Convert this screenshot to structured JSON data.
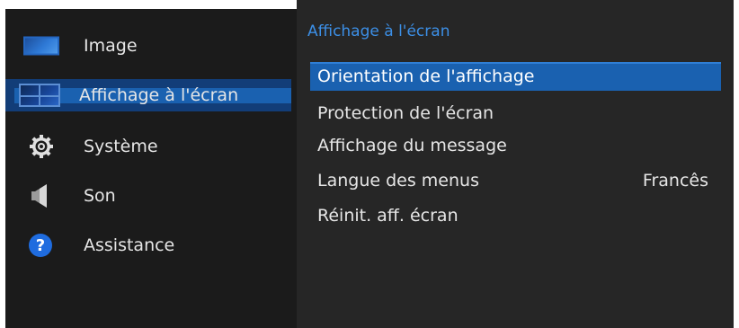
{
  "left_menu": {
    "items": [
      {
        "label": "Image",
        "icon": "image-icon"
      },
      {
        "label": "Affichage à l'écran",
        "icon": "on-screen-display-icon",
        "selected": true
      },
      {
        "label": "Système",
        "icon": "gear-icon"
      },
      {
        "label": "Son",
        "icon": "speaker-icon"
      },
      {
        "label": "Assistance",
        "icon": "help-icon"
      }
    ]
  },
  "sub_menu": {
    "title": "Affichage à l'écran",
    "items": [
      {
        "label": "Orientation de l'affichage",
        "value": "",
        "selected": true
      },
      {
        "label": "Protection de l'écran",
        "value": ""
      },
      {
        "label": "Affichage du message",
        "value": ""
      },
      {
        "label": "Langue des menus",
        "value": "Francês"
      },
      {
        "label": "Réinit. aff. écran",
        "value": ""
      }
    ]
  },
  "colors": {
    "left_background": "#1b1b1b",
    "right_background": "#262626",
    "highlight": "#1a61b0",
    "title_accent": "#3c8fe6",
    "text": "#e6e6e6"
  },
  "help_glyph": "?"
}
